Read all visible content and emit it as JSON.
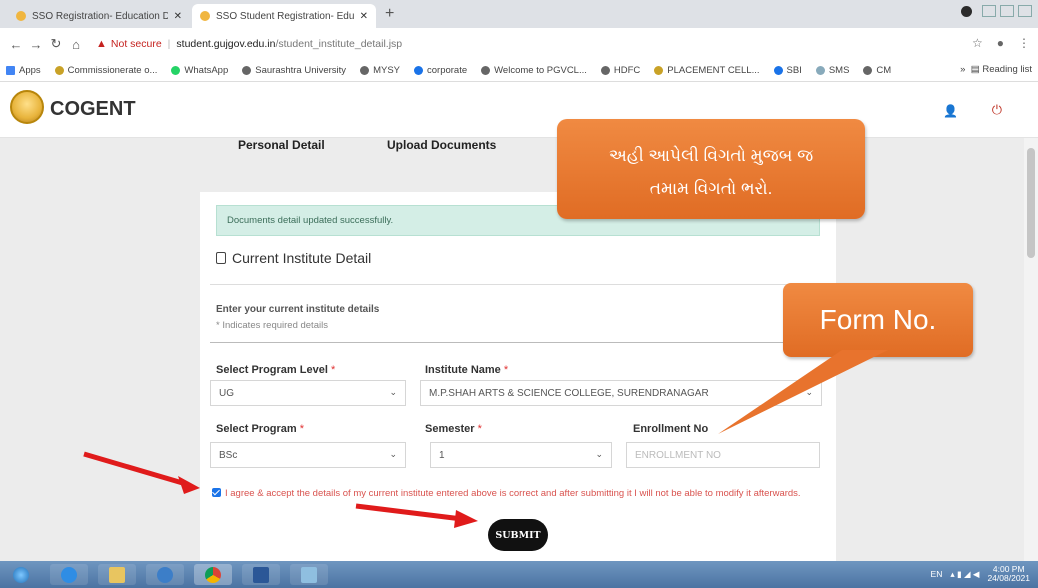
{
  "browser": {
    "tabs": [
      {
        "title": "SSO Registration- Education De"
      },
      {
        "title": "SSO Student Registration- Educ"
      }
    ],
    "address": {
      "security": "Not secure",
      "host": "student.gujgov.edu.in",
      "path": "/student_institute_detail.jsp"
    },
    "bookmarks": [
      "Apps",
      "Commissionerate o...",
      "WhatsApp",
      "Saurashtra University",
      "MYSY",
      "corporate",
      "Welcome to PGVCL...",
      "HDFC",
      "PLACEMENT CELL...",
      "SBI",
      "SMS",
      "CM"
    ],
    "reading_list": "Reading list"
  },
  "app": {
    "brand": "COGENT",
    "nav": {
      "personal": "Personal Detail",
      "upload": "Upload Documents"
    }
  },
  "form": {
    "alert": "Documents detail updated successfully.",
    "section_title": "Current Institute Detail",
    "intro": "Enter your current institute details",
    "required_note": "* Indicates required details",
    "program_level": {
      "label": "Select Program Level",
      "value": "UG"
    },
    "institute": {
      "label": "Institute Name",
      "value": "M.P.SHAH ARTS & SCIENCE COLLEGE, SURENDRANAGAR"
    },
    "program": {
      "label": "Select Program",
      "value": "BSc"
    },
    "semester": {
      "label": "Semester",
      "value": "1"
    },
    "enrollment": {
      "label": "Enrollment No",
      "placeholder": "ENROLLMENT NO"
    },
    "agree_text": "I agree & accept the details of my current institute entered above is correct and after submitting it I will not be able to modify it afterwards.",
    "submit": "SUBMIT",
    "required_mark": "*"
  },
  "annotations": {
    "callout_gu_line1": "અહી આપેલી વિગતો મુજબ જ",
    "callout_gu_line2": "તમામ વિગતો ભરો.",
    "callout_form": "Form No."
  },
  "taskbar": {
    "lang": "EN",
    "time": "4:00 PM",
    "date": "24/08/2021"
  }
}
